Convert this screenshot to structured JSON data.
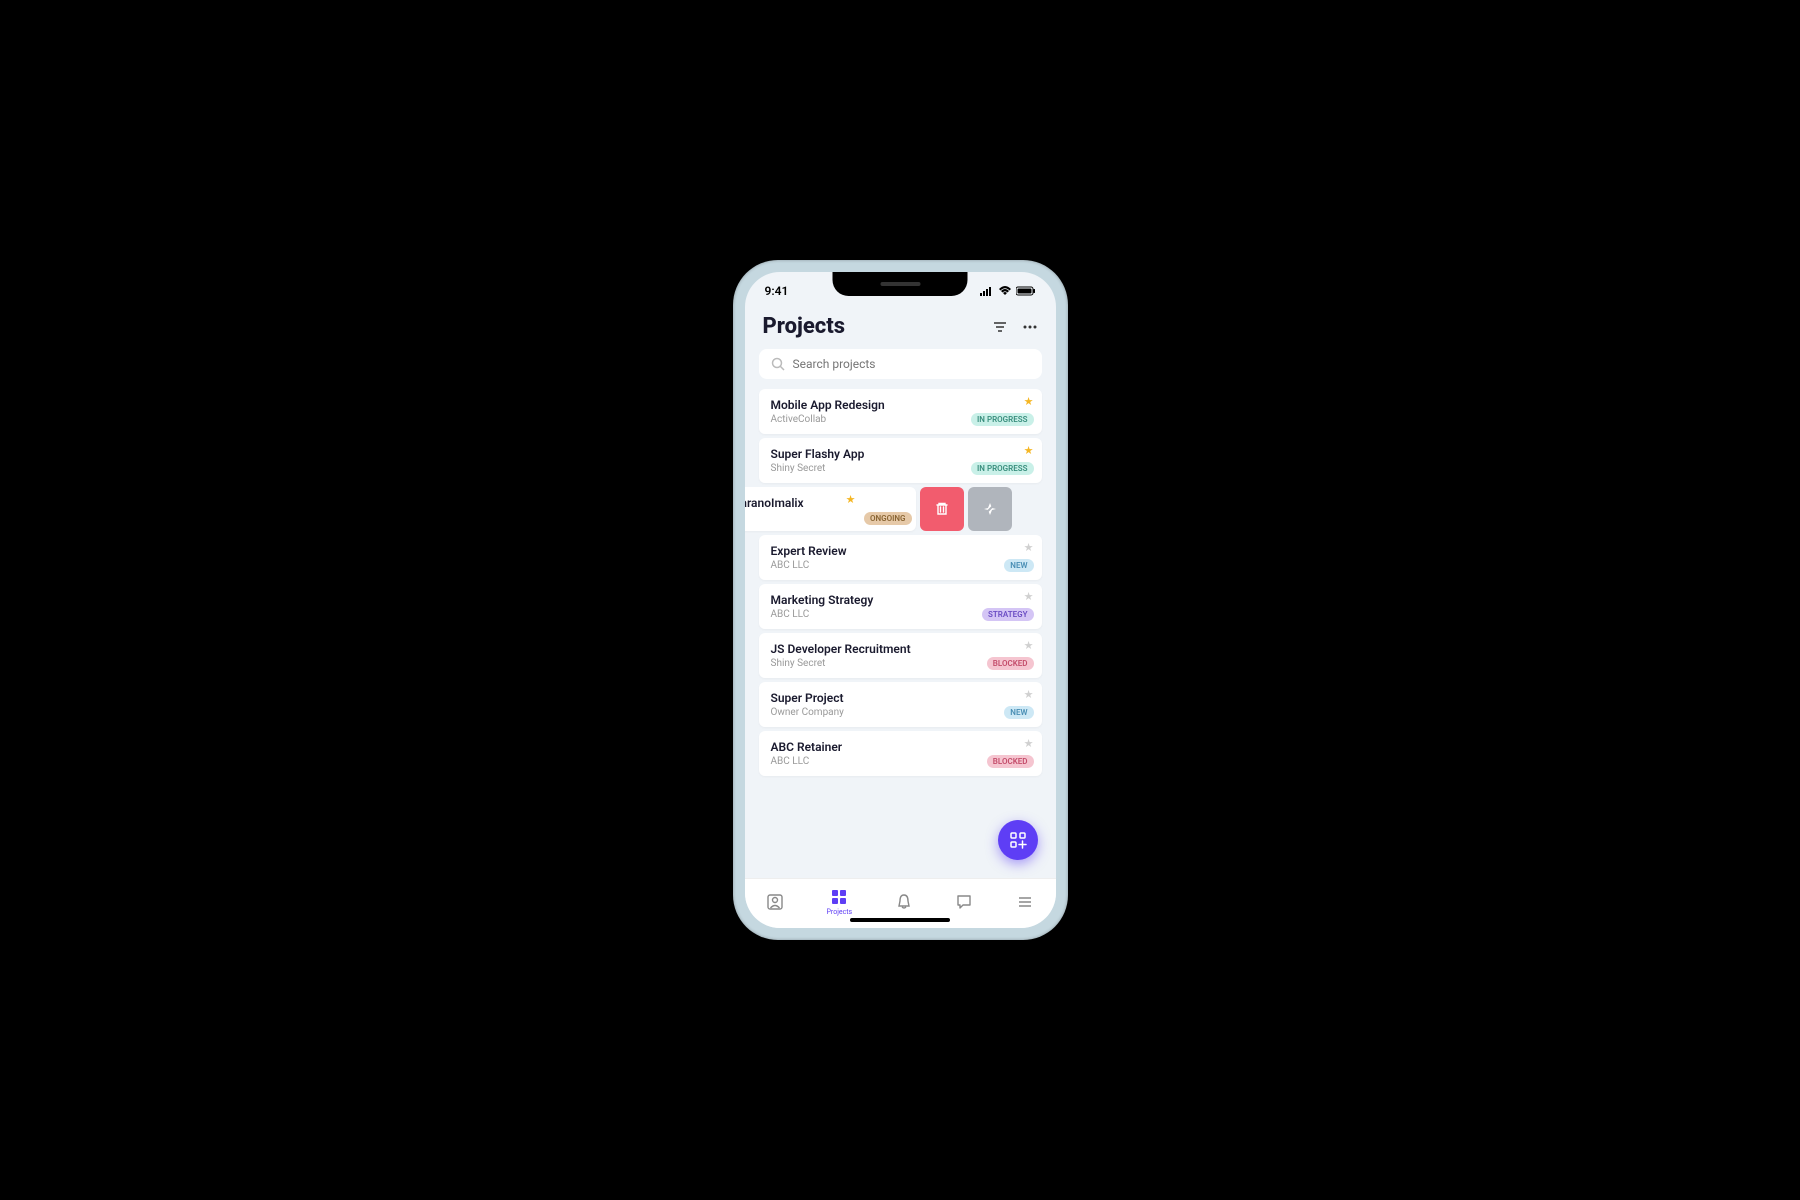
{
  "status": {
    "time": "9:41"
  },
  "header": {
    "title": "Projects"
  },
  "search": {
    "placeholder": "Search projects"
  },
  "projects": [
    {
      "title": "Mobile App Redesign",
      "owner": "ActiveCollab",
      "badge": "IN PROGRESS",
      "badge_class": "badge-progress",
      "starred": true
    },
    {
      "title": "Super Flashy App",
      "owner": "Shiny Secret",
      "badge": "IN PROGRESS",
      "badge_class": "badge-progress",
      "starred": true
    },
    {
      "title": "aranoImalix",
      "owner": "",
      "badge": "ONGOING",
      "badge_class": "badge-ongoing",
      "starred": true,
      "swiped": true
    },
    {
      "title": "Expert Review",
      "owner": "ABC LLC",
      "badge": "NEW",
      "badge_class": "badge-new",
      "starred": false
    },
    {
      "title": "Marketing Strategy",
      "owner": "ABC LLC",
      "badge": "STRATEGY",
      "badge_class": "badge-strategy",
      "starred": false
    },
    {
      "title": "JS Developer Recruitment",
      "owner": "Shiny Secret",
      "badge": "BLOCKED",
      "badge_class": "badge-blocked",
      "starred": false
    },
    {
      "title": "Super Project",
      "owner": "Owner Company",
      "badge": "NEW",
      "badge_class": "badge-new",
      "starred": false
    },
    {
      "title": "ABC Retainer",
      "owner": "ABC LLC",
      "badge": "BLOCKED",
      "badge_class": "badge-blocked",
      "starred": false
    }
  ],
  "tabs": {
    "projects": "Projects"
  }
}
